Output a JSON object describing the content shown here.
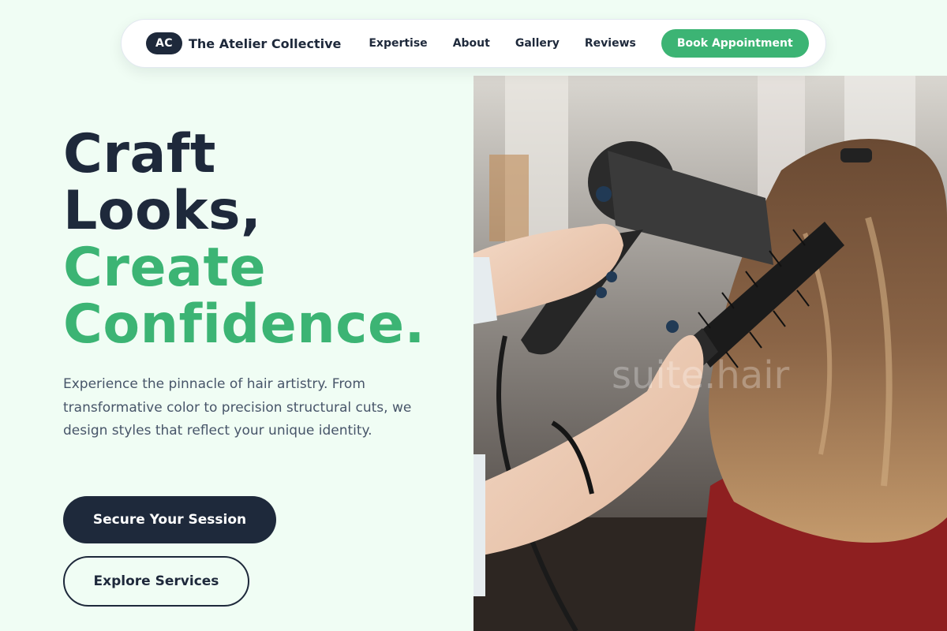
{
  "nav": {
    "logo_badge": "AC",
    "brand_name": "The Atelier Collective",
    "links": [
      "Expertise",
      "About",
      "Gallery",
      "Reviews"
    ],
    "cta": "Book Appointment"
  },
  "hero": {
    "title_line1": "Craft",
    "title_line2": "Looks,",
    "title_line3": "Create",
    "title_line4": "Confidence.",
    "subtitle": "Experience the pinnacle of hair artistry. From transformative color to precision structural cuts, we design styles that reflect your unique identity.",
    "primary_button": "Secure Your Session",
    "secondary_button": "Explore Services",
    "image_watermark": "suite.hair"
  },
  "colors": {
    "background": "#f0fdf4",
    "navy": "#1e293b",
    "accent_green": "#3cb474",
    "body_text": "#475569"
  }
}
